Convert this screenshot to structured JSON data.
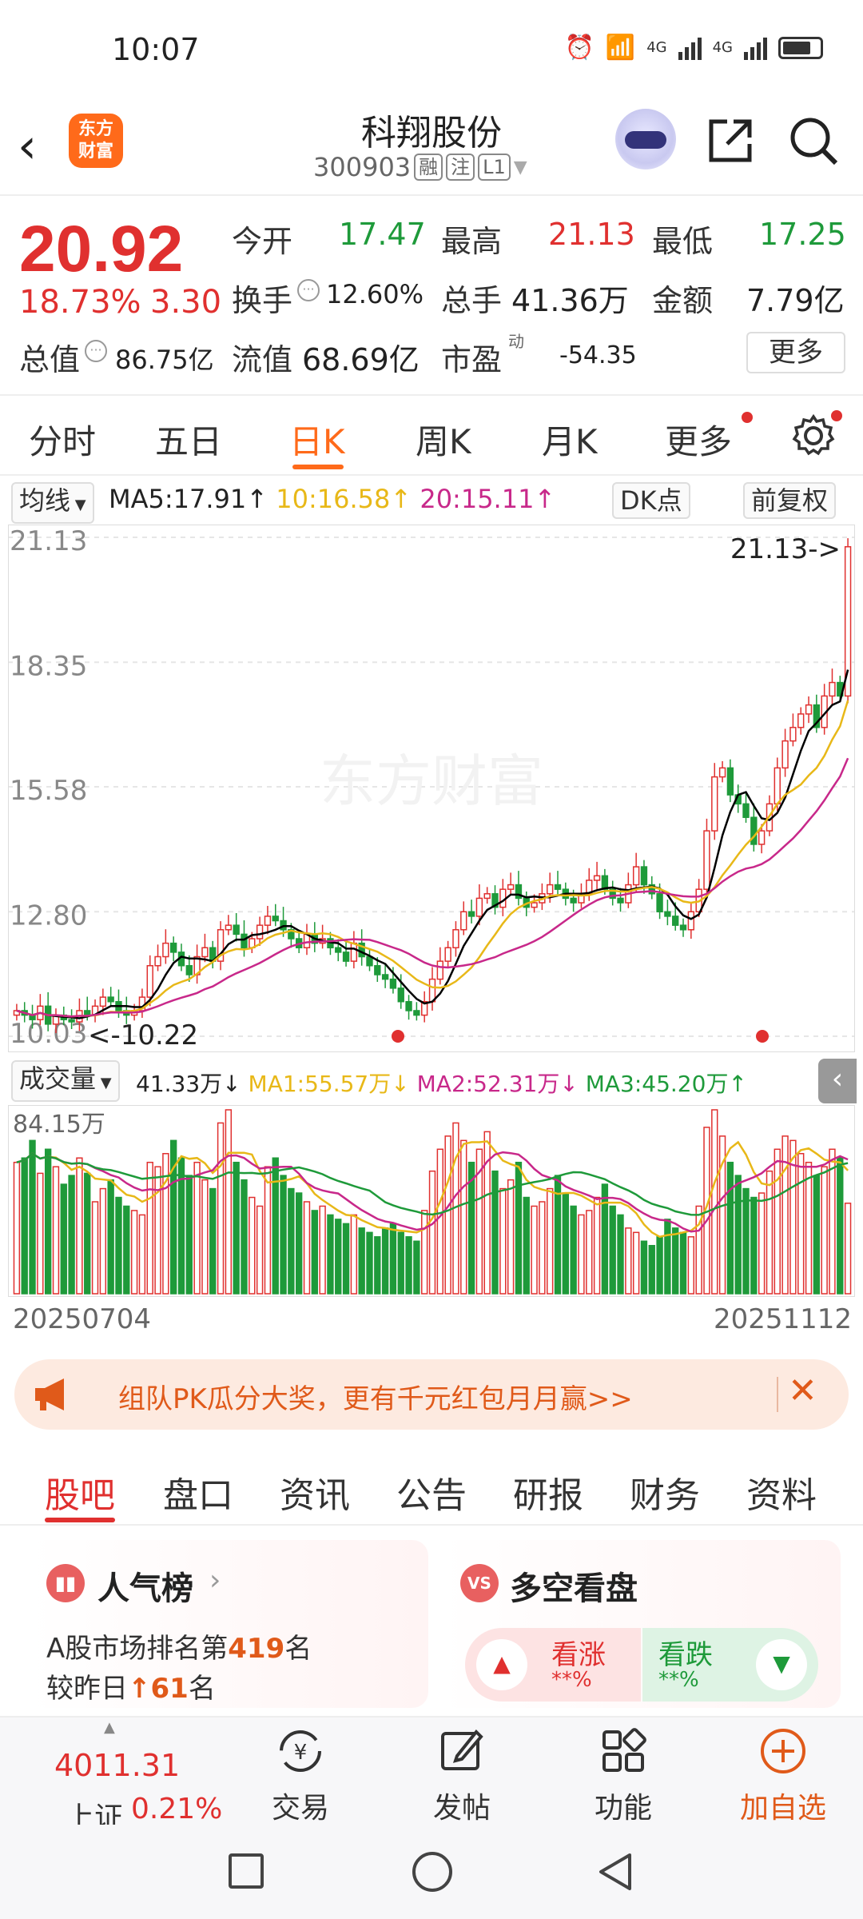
{
  "status": {
    "time": "10:07",
    "net1": "4G",
    "net2": "4G"
  },
  "header": {
    "logo": "东方\n财富",
    "name": "科翔股份",
    "code": "300903",
    "tag1": "融",
    "tag2": "注",
    "tag3": "L1"
  },
  "quote": {
    "price": "20.92",
    "change_pct": "18.73%",
    "change_amt": "3.30",
    "open_label": "今开",
    "open": "17.47",
    "high_label": "最高",
    "high": "21.13",
    "low_label": "最低",
    "low": "17.25",
    "turnover_label": "换手",
    "turnover": "12.60%",
    "volume_label": "总手",
    "volume": "41.36万",
    "amount_label": "金额",
    "amount": "7.79亿",
    "mktcap_label": "总值",
    "mktcap": "86.75亿",
    "float_label": "流值",
    "float": "68.69亿",
    "pe_label": "市盈",
    "pe_sup": "动",
    "pe": "-54.35",
    "more": "更多"
  },
  "chart_tabs": [
    "分时",
    "五日",
    "日K",
    "周K",
    "月K",
    "更多"
  ],
  "ma_bar": {
    "type": "均线",
    "ma5": "MA5:17.91↑",
    "ma10": "10:16.58↑",
    "ma20": "20:15.11↑",
    "dk": "DK点",
    "adjust": "前复权"
  },
  "vol_bar": {
    "type": "成交量",
    "vol": "41.33万↓",
    "ma1": "MA1:55.57万↓",
    "ma2": "MA2:52.31万↓",
    "ma3": "MA3:45.20万↑",
    "max_label": "84.15万"
  },
  "chart_data": {
    "type": "candlestick",
    "y_ticks": [
      "21.13",
      "18.35",
      "15.58",
      "12.80",
      "10.03"
    ],
    "ylim": [
      10.03,
      21.13
    ],
    "high_marker": "21.13->",
    "low_marker": "<-10.22",
    "watermark": "东方财富",
    "start_date": "20250704",
    "end_date": "20251112",
    "closes": [
      10.6,
      10.5,
      10.4,
      10.7,
      10.3,
      10.5,
      10.4,
      10.35,
      10.6,
      10.5,
      10.7,
      10.9,
      10.8,
      10.6,
      10.5,
      10.6,
      10.9,
      11.6,
      11.8,
      12.1,
      11.9,
      11.6,
      11.4,
      11.8,
      12.0,
      11.7,
      12.4,
      12.5,
      12.3,
      12.0,
      12.2,
      12.5,
      12.7,
      12.6,
      12.4,
      12.2,
      12.0,
      12.3,
      12.1,
      12.2,
      12.0,
      11.9,
      11.7,
      12.1,
      11.8,
      11.6,
      11.4,
      11.3,
      11.1,
      10.8,
      10.6,
      10.5,
      10.8,
      11.3,
      11.7,
      12.0,
      12.4,
      12.8,
      12.7,
      13.1,
      13.2,
      12.9,
      13.3,
      13.4,
      13.1,
      12.9,
      13.0,
      13.2,
      13.4,
      13.3,
      13.1,
      13.0,
      13.2,
      13.5,
      13.6,
      13.3,
      13.1,
      13.0,
      13.4,
      13.8,
      13.4,
      13.2,
      12.8,
      12.7,
      12.5,
      12.4,
      12.8,
      13.3,
      14.6,
      15.8,
      16.0,
      15.4,
      15.2,
      14.9,
      14.3,
      14.6,
      15.2,
      16.0,
      16.6,
      16.9,
      17.2,
      17.4,
      16.9,
      17.6,
      17.9,
      17.6,
      20.92
    ],
    "volume": [
      60,
      62,
      70,
      55,
      66,
      58,
      50,
      54,
      62,
      55,
      42,
      48,
      52,
      44,
      40,
      38,
      36,
      60,
      58,
      64,
      70,
      62,
      54,
      60,
      52,
      48,
      78,
      84,
      60,
      52,
      44,
      40,
      58,
      62,
      54,
      48,
      46,
      42,
      38,
      40,
      36,
      34,
      32,
      36,
      30,
      28,
      26,
      30,
      32,
      28,
      26,
      24,
      38,
      56,
      66,
      72,
      78,
      70,
      60,
      66,
      74,
      56,
      48,
      52,
      60,
      44,
      40,
      42,
      48,
      54,
      46,
      40,
      36,
      38,
      44,
      50,
      40,
      36,
      30,
      28,
      24,
      22,
      26,
      34,
      30,
      28,
      26,
      40,
      76,
      84,
      72,
      60,
      54,
      48,
      44,
      46,
      56,
      66,
      72,
      70,
      64,
      60,
      54,
      58,
      66,
      62,
      41.33
    ]
  },
  "banner": {
    "text": "组队PK瓜分大奖，更有千元红包月月赢>>"
  },
  "info_tabs": [
    "股吧",
    "盘口",
    "资讯",
    "公告",
    "研报",
    "财务",
    "资料"
  ],
  "popularity": {
    "title": "人气榜",
    "line1a": "A股市场排名第",
    "rank": "419",
    "line1b": "名",
    "line2a": "较昨日",
    "delta": "61",
    "line2b": "名"
  },
  "longshort": {
    "title": "多空看盘",
    "rise": "看涨",
    "rise_pct": "**%",
    "fall": "看跌",
    "fall_pct": "**%",
    "vs": "VS"
  },
  "bottom_nav": {
    "index_value": "4011.31",
    "index_name": "上证",
    "index_pct": "0.21%",
    "trade": "交易",
    "post": "发帖",
    "func": "功能",
    "add": "加自选"
  },
  "colors": {
    "up": "#e0302f",
    "down": "#1e9a3a",
    "accent": "#ff6a1a",
    "ma5": "#000000",
    "ma10": "#e8b818",
    "ma20": "#c8288a"
  }
}
